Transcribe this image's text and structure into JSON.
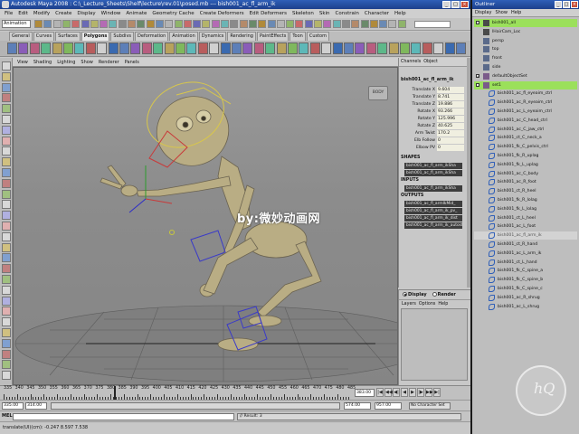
{
  "window": {
    "title": "Autodesk Maya 2008 : C:\\_Lecture_Sheets\\Shelf\\lecture\\rev.01\\posed.mb  ---  bish001_ac_fl_arm_ik",
    "minimize": "_",
    "maximize": "□",
    "close": "×"
  },
  "menubar": [
    "File",
    "Edit",
    "Modify",
    "Create",
    "Display",
    "Window",
    "Animate",
    "Geometry Cache",
    "Create Deformers",
    "Edit Deformers",
    "Skeleton",
    "Skin",
    "Constrain",
    "Character",
    "Help"
  ],
  "statusline": {
    "mode": "Animation"
  },
  "shelf_tabs": [
    "General",
    "Curves",
    "Surfaces",
    "Polygons",
    "Subdivs",
    "Deformation",
    "Animation",
    "Dynamics",
    "Rendering",
    "PaintEffects",
    "Toon",
    "Custom"
  ],
  "shelf_active_tab": "Polygons",
  "viewport": {
    "menu": [
      "View",
      "Shading",
      "Lighting",
      "Show",
      "Renderer",
      "Panels"
    ],
    "camera_label": "BODY",
    "watermark": "by:微妙动画网"
  },
  "channel_box": {
    "menu": [
      "Channels",
      "Object"
    ],
    "object_name": "bish001_ac_fl_arm_ik",
    "channels": [
      {
        "label": "Translate X",
        "value": "9.604"
      },
      {
        "label": "Translate Y",
        "value": "8.741"
      },
      {
        "label": "Translate Z",
        "value": "19.886"
      },
      {
        "label": "Rotate X",
        "value": "93.266"
      },
      {
        "label": "Rotate Y",
        "value": "125.996"
      },
      {
        "label": "Rotate Z",
        "value": "40.625"
      },
      {
        "label": "Arm Twist",
        "value": "170.2"
      },
      {
        "label": "Elb Follow",
        "value": "0"
      },
      {
        "label": "Elbow PV",
        "value": "0"
      }
    ],
    "shapes_label": "SHAPES",
    "shapes": [
      "bish001_ac_fl_arm_ikSha",
      "bish001_ac_fl_arm_ikSha"
    ],
    "inputs_label": "INPUTS",
    "inputs": [
      "bish001_ac_fl_arm_ikSha"
    ],
    "outputs_label": "OUTPUTS",
    "outputs": [
      "bish001_ac_fl_armIkMid_",
      "bish001_ac_fl_arm_ik_pv_",
      "bish001_ac_fl_arm_ik_dist",
      "bish001_ac_fl_arm_ik_autostretch"
    ]
  },
  "layer_editor": {
    "display_label": "Display",
    "render_label": "Render",
    "menu": [
      "Layers",
      "Options",
      "Help"
    ]
  },
  "time_slider": {
    "ticks": [
      "335",
      "340",
      "345",
      "350",
      "355",
      "360",
      "365",
      "370",
      "375",
      "380",
      "385",
      "390",
      "395",
      "400",
      "405",
      "410",
      "415",
      "420",
      "425",
      "430",
      "435",
      "440",
      "445",
      "450",
      "455",
      "460",
      "465",
      "470",
      "475",
      "480",
      "485"
    ],
    "current_frame": "383.00",
    "controls": [
      "|◀",
      "◀◀",
      "◀|",
      "◀",
      "▶",
      "|▶",
      "▶▶",
      "▶|"
    ]
  },
  "range_slider": {
    "start": "335.00",
    "inner_start": "314.00",
    "inner_end": "574.00",
    "end": "957.00",
    "character_set": "No Character Set"
  },
  "command_line": {
    "label": "MEL",
    "result": "// Result: 3"
  },
  "help_line": "translate(UI)(cm): -0.247     8.597     7.538",
  "outliner": {
    "title": "Outliner",
    "menu": [
      "Display",
      "Show",
      "Help"
    ],
    "items": [
      {
        "label": "bish001_all",
        "depth": 0,
        "kind": "group",
        "highlight": true
      },
      {
        "label": "lHairCam_Loc",
        "depth": 0,
        "kind": "transform"
      },
      {
        "label": "persp",
        "depth": 0,
        "kind": "camera"
      },
      {
        "label": "top",
        "depth": 0,
        "kind": "camera"
      },
      {
        "label": "front",
        "depth": 0,
        "kind": "camera"
      },
      {
        "label": "side",
        "depth": 0,
        "kind": "camera"
      },
      {
        "label": "defaultObjectSet",
        "depth": 0,
        "kind": "set"
      },
      {
        "label": "set1",
        "depth": 0,
        "kind": "set",
        "highlight": true
      },
      {
        "label": "bish001_ac_fl_eyeaim_ctrl",
        "depth": 1,
        "kind": "curve"
      },
      {
        "label": "bish001_ac_R_eyeaim_ctrl",
        "depth": 1,
        "kind": "curve"
      },
      {
        "label": "bish001_ac_L_eyeaim_ctrl",
        "depth": 1,
        "kind": "curve"
      },
      {
        "label": "bish001_ac_C_head_ctrl",
        "depth": 1,
        "kind": "curve"
      },
      {
        "label": "bish001_ac_C_jaw_ctrl",
        "depth": 1,
        "kind": "curve"
      },
      {
        "label": "bish001_ct_C_neck_a",
        "depth": 1,
        "kind": "curve"
      },
      {
        "label": "bish001_fk_C_pelvis_ctrl",
        "depth": 1,
        "kind": "curve"
      },
      {
        "label": "bish001_fk_R_uplag",
        "depth": 1,
        "kind": "curve"
      },
      {
        "label": "bish001_fk_L_uplag",
        "depth": 1,
        "kind": "curve"
      },
      {
        "label": "bish001_ac_C_body",
        "depth": 1,
        "kind": "curve"
      },
      {
        "label": "bish001_ac_R_foot",
        "depth": 1,
        "kind": "curve"
      },
      {
        "label": "bish001_ct_R_heel",
        "depth": 1,
        "kind": "curve"
      },
      {
        "label": "bish001_fk_R_lolag",
        "depth": 1,
        "kind": "curve"
      },
      {
        "label": "bish001_fk_L_lolag",
        "depth": 1,
        "kind": "curve"
      },
      {
        "label": "bish001_ct_L_heel",
        "depth": 1,
        "kind": "curve"
      },
      {
        "label": "bish001_ac_L_foot",
        "depth": 1,
        "kind": "curve"
      },
      {
        "label": "bish001_ac_fl_arm_ik",
        "depth": 1,
        "kind": "curve",
        "selected": true
      },
      {
        "label": "bish001_ct_R_hand",
        "depth": 1,
        "kind": "curve"
      },
      {
        "label": "bish001_ac_L_arm_ik",
        "depth": 1,
        "kind": "curve"
      },
      {
        "label": "bish001_ct_L_hand",
        "depth": 1,
        "kind": "curve"
      },
      {
        "label": "bish001_fk_C_spine_a",
        "depth": 1,
        "kind": "curve"
      },
      {
        "label": "bish001_fk_C_spine_b",
        "depth": 1,
        "kind": "curve"
      },
      {
        "label": "bish001_fk_C_spine_c",
        "depth": 1,
        "kind": "curve"
      },
      {
        "label": "bish001_ac_R_shrug",
        "depth": 1,
        "kind": "curve"
      },
      {
        "label": "bish001_ac_L_shrug",
        "depth": 1,
        "kind": "curve"
      }
    ]
  },
  "logo_text": "hQ",
  "colors": {
    "titlebar": "#1c3f8c",
    "outliner_highlight": "#9be05b",
    "channel_value_bg": "#f0efe0",
    "viewport_bg": "#8c8c8c"
  }
}
